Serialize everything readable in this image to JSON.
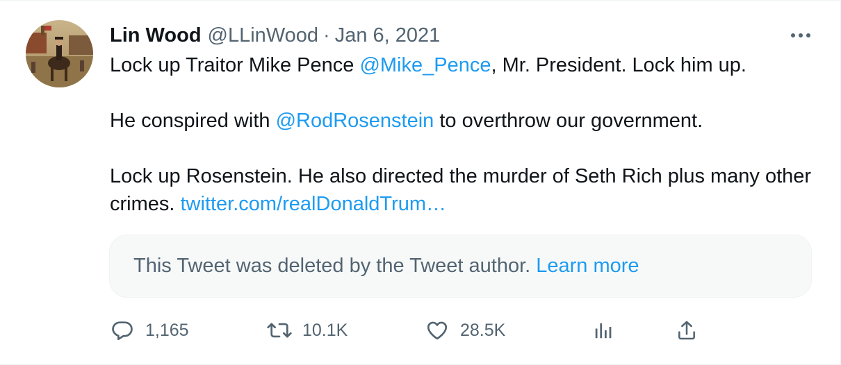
{
  "tweet": {
    "display_name": "Lin Wood",
    "handle": "@LLinWood",
    "separator": "·",
    "date": "Jan 6, 2021",
    "body": {
      "line1_before": "Lock up Traitor Mike Pence ",
      "line1_mention": "@Mike_Pence",
      "line1_after": ", Mr. President. Lock him up.",
      "line2_before": "He conspired with ",
      "line2_mention": "@RodRosenstein",
      "line2_after": " to overthrow our government.",
      "line3_text": "Lock up Rosenstein. He also directed the murder of Seth Rich plus many other crimes. ",
      "line3_link": "twitter.com/realDonaldTrum…"
    },
    "quoted": {
      "message": "This Tweet was deleted by the Tweet author.",
      "learn_more": "Learn more"
    },
    "actions": {
      "replies": "1,165",
      "retweets": "10.1K",
      "likes": "28.5K"
    }
  },
  "icons": {
    "more": "more-horizontal-icon",
    "reply": "reply-bubble-icon",
    "retweet": "retweet-arrows-icon",
    "like": "heart-icon",
    "analytics": "bar-chart-icon",
    "share": "share-upload-icon"
  },
  "colors": {
    "text": "#0f1419",
    "secondary": "#536471",
    "link": "#1d9bf0",
    "quote_bg": "#f7f9f9",
    "border": "#eff3f4"
  }
}
